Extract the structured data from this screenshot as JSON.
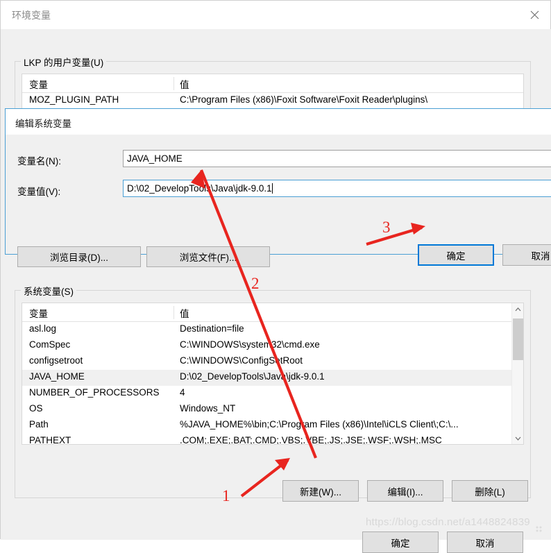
{
  "window": {
    "title": "环境变量",
    "close_icon": "close-icon"
  },
  "user_section": {
    "legend": "LKP 的用户变量(U)",
    "columns": [
      "变量",
      "值"
    ],
    "rows": [
      {
        "name": "MOZ_PLUGIN_PATH",
        "value": "C:\\Program Files (x86)\\Foxit Software\\Foxit Reader\\plugins\\"
      }
    ]
  },
  "system_section": {
    "legend": "系统变量(S)",
    "columns": [
      "变量",
      "值"
    ],
    "rows": [
      {
        "name": "asl.log",
        "value": "Destination=file",
        "selected": false
      },
      {
        "name": "ComSpec",
        "value": "C:\\WINDOWS\\system32\\cmd.exe",
        "selected": false
      },
      {
        "name": "configsetroot",
        "value": "C:\\WINDOWS\\ConfigSetRoot",
        "selected": false
      },
      {
        "name": "JAVA_HOME",
        "value": "D:\\02_DevelopTools\\Java\\jdk-9.0.1",
        "selected": true
      },
      {
        "name": "NUMBER_OF_PROCESSORS",
        "value": "4",
        "selected": false
      },
      {
        "name": "OS",
        "value": "Windows_NT",
        "selected": false
      },
      {
        "name": "Path",
        "value": "%JAVA_HOME%\\bin;C:\\Program Files (x86)\\Intel\\iCLS Client\\;C:\\...",
        "selected": false
      },
      {
        "name": "PATHEXT",
        "value": ".COM;.EXE;.BAT;.CMD;.VBS;.VBE;.JS;.JSE;.WSF;.WSH;.MSC",
        "selected": false
      }
    ],
    "buttons": {
      "new": "新建(W)...",
      "edit": "编辑(I)...",
      "delete": "删除(L)"
    }
  },
  "main_buttons": {
    "ok": "确定",
    "cancel": "取消"
  },
  "edit_dialog": {
    "title": "编辑系统变量",
    "name_label": "变量名(N):",
    "name_value": "JAVA_HOME",
    "value_label": "变量值(V):",
    "value_value": "D:\\02_DevelopTools\\Java\\jdk-9.0.1",
    "browse_dir": "浏览目录(D)...",
    "browse_file": "浏览文件(F)...",
    "ok": "确定",
    "cancel": "取消"
  },
  "annotations": {
    "step1": "1",
    "step2": "2",
    "step3": "3",
    "color": "#e8251f"
  },
  "watermark": {
    "text": "https://blog.csdn.net/a1448824839"
  }
}
